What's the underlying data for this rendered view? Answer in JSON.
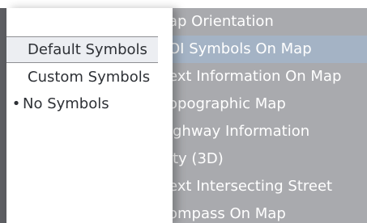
{
  "background_menu": {
    "items": [
      {
        "label": "ap Orientation"
      },
      {
        "label": "OI Symbols On Map",
        "selected": true
      },
      {
        "label": "ext Information On Map"
      },
      {
        "label": "opographic Map"
      },
      {
        "label": "ighway Information"
      },
      {
        "label": "ity (3D)"
      },
      {
        "label": "ext Intersecting Street"
      },
      {
        "label": "ompass On Map"
      }
    ]
  },
  "popup": {
    "items": [
      {
        "label": "Default Symbols",
        "highlighted": true
      },
      {
        "label": "Custom Symbols"
      },
      {
        "bullet": "•",
        "label": "No Symbols",
        "active": true
      }
    ]
  }
}
